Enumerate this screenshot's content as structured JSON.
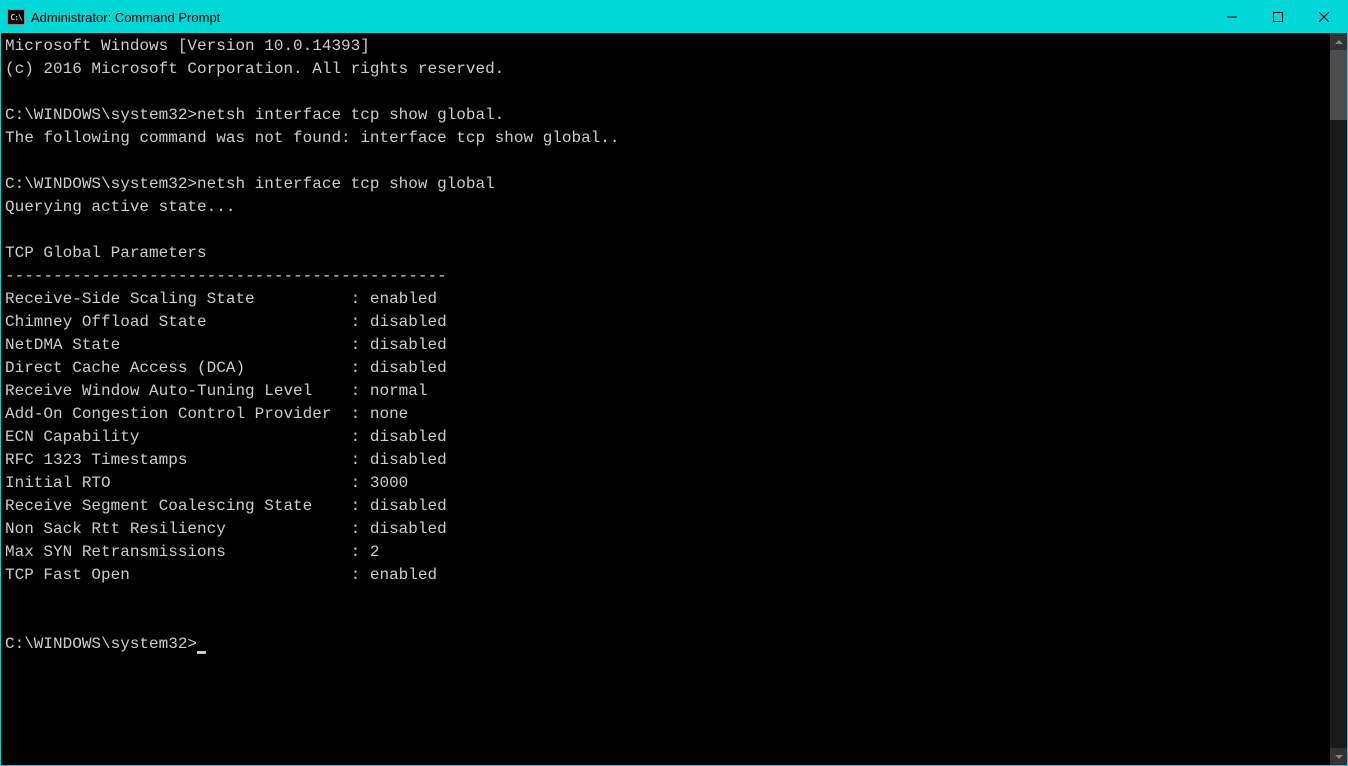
{
  "window": {
    "icon_text": "C:\\",
    "title": "Administrator: Command Prompt"
  },
  "terminal": {
    "header_line1": "Microsoft Windows [Version 10.0.14393]",
    "header_line2": "(c) 2016 Microsoft Corporation. All rights reserved.",
    "prompt1_path": "C:\\WINDOWS\\system32>",
    "prompt1_cmd": "netsh interface tcp show global.",
    "error_line": "The following command was not found: interface tcp show global..",
    "prompt2_path": "C:\\WINDOWS\\system32>",
    "prompt2_cmd": "netsh interface tcp show global",
    "querying": "Querying active state...",
    "section_title": "TCP Global Parameters",
    "divider": "----------------------------------------------",
    "params": [
      {
        "label": "Receive-Side Scaling State          ",
        "value": ": enabled"
      },
      {
        "label": "Chimney Offload State               ",
        "value": ": disabled"
      },
      {
        "label": "NetDMA State                        ",
        "value": ": disabled"
      },
      {
        "label": "Direct Cache Access (DCA)           ",
        "value": ": disabled"
      },
      {
        "label": "Receive Window Auto-Tuning Level    ",
        "value": ": normal"
      },
      {
        "label": "Add-On Congestion Control Provider  ",
        "value": ": none"
      },
      {
        "label": "ECN Capability                      ",
        "value": ": disabled"
      },
      {
        "label": "RFC 1323 Timestamps                 ",
        "value": ": disabled"
      },
      {
        "label": "Initial RTO                         ",
        "value": ": 3000"
      },
      {
        "label": "Receive Segment Coalescing State    ",
        "value": ": disabled"
      },
      {
        "label": "Non Sack Rtt Resiliency             ",
        "value": ": disabled"
      },
      {
        "label": "Max SYN Retransmissions             ",
        "value": ": 2"
      },
      {
        "label": "TCP Fast Open                       ",
        "value": ": enabled"
      }
    ],
    "prompt3_path": "C:\\WINDOWS\\system32>"
  }
}
